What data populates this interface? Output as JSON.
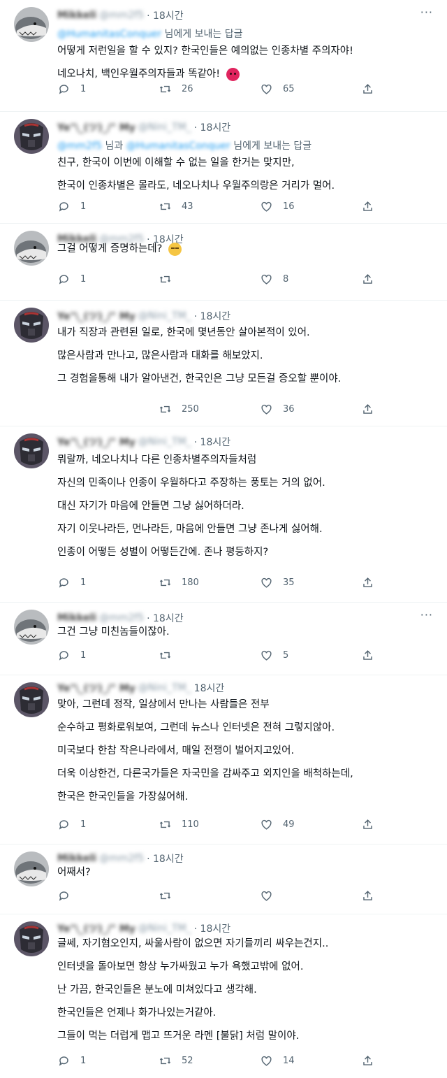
{
  "tweets": [
    {
      "author": "shark",
      "name": "Mikkeli",
      "handle": "@mm2f5",
      "time": "· 18시간",
      "reply_prefix": "",
      "reply_mention1": "@HumanitasConquer",
      "reply_mid": "",
      "reply_mention2": "",
      "reply_suffix": "님에게 보내는 답글",
      "lines": [
        "어떻게 저런일을 할 수 있지? 한국인들은 예의없는 인종차별 주의자야!",
        "네오나치, 백인우월주의자들과 똑같아!"
      ],
      "emoji": "angry-face-emoji",
      "replies": "1",
      "retweets": "26",
      "likes": "65"
    },
    {
      "author": "mask",
      "name": "Ye\"\\_(ツ)_/\" My",
      "handle": "@Nini_TM_",
      "time": "· 18시간",
      "reply_mention1": "@mm2f5",
      "reply_mid": "님과",
      "reply_mention2": "@HumanitasConquer",
      "reply_suffix": "님에게 보내는 답글",
      "lines": [
        "친구, 한국이 이번에 이해할 수 없는 일을 한거는 맞지만,",
        "한국이 인종차별은 몰라도, 네오나치나 우월주의랑은 거리가 멀어."
      ],
      "replies": "1",
      "retweets": "43",
      "likes": "16"
    },
    {
      "author": "shark",
      "name": "Mikkeli",
      "handle": "@mm2f5",
      "time": "· 18시간",
      "lines": [
        "그걸 어떻게 증명하는데?"
      ],
      "emoji": "unamused-face-emoji",
      "replies": "1",
      "retweets": "",
      "likes": "8"
    },
    {
      "author": "mask",
      "name": "Ye\"\\_(ツ)_/\" My",
      "handle": "@Nini_TM_",
      "time": "· 18시간",
      "lines": [
        "내가 직장과 관련된 일로, 한국에 몇년동안 살아본적이 있어.",
        "많은사람과 만나고, 많은사람과 대화를 해보았지.",
        "그 경험을통해 내가 알아낸건, 한국인은 그냥 모든걸 증오할 뿐이야."
      ],
      "replies": "",
      "retweets": "250",
      "likes": "36"
    },
    {
      "author": "mask",
      "name": "Ye\"\\_(ツ)_/\" My",
      "handle": "@Nini_TM_",
      "time": "· 18시간",
      "lines": [
        "뭐랄까, 네오나치나 다른 인종차별주의자들처럼",
        "자신의 민족이나 인종이 우월하다고 주장하는 풍토는 거의 없어.",
        "대신 자기가 마음에 안들면 그냥 싫어하더라.",
        "자기 이웃나라든, 먼나라든, 마음에 안들면 그냥 존나게 싫어해.",
        "인종이 어떻든 성별이 어떻든간에. 존나 평등하지?"
      ],
      "replies": "1",
      "retweets": "180",
      "likes": "35"
    },
    {
      "author": "shark",
      "name": "Mikkeli",
      "handle": "@mm2f5",
      "time": "· 18시간",
      "lines": [
        "그건 그냥 미친놈들이잖아."
      ],
      "replies": "1",
      "retweets": "",
      "likes": "5"
    },
    {
      "author": "mask",
      "name": "Ye\"\\_(ツ)_/\" My",
      "handle": "@Nini_TM_",
      "time": "18시간",
      "lines": [
        "맞아, 그런데 정작, 일상에서 만나는 사람들은 전부",
        "순수하고 평화로워보여, 그런데 뉴스나 인터넷은 전혀 그렇지않아.",
        "미국보다 한참 작은나라에서, 매일 전쟁이 벌어지고있어.",
        "더욱 이상한건, 다른국가들은 자국민을 감싸주고 외지인을 배척하는데,",
        "한국은 한국인들을 가장싫어해."
      ],
      "replies": "1",
      "retweets": "110",
      "likes": "49"
    },
    {
      "author": "shark",
      "name": "Mikkeli",
      "handle": "@mm2f5",
      "time": "· 18시간",
      "lines": [
        "어째서?"
      ],
      "replies": "",
      "retweets": "",
      "likes": ""
    },
    {
      "author": "mask",
      "name": "Ye\"\\_(ツ)_/\" My",
      "handle": "@Nini_TM_",
      "time": "· 18시간",
      "lines": [
        "글쎄, 자기혐오인지, 싸울사람이 없으면 자기들끼리 싸우는건지..",
        "인터넷을 돌아보면 항상 누가싸웠고 누가 욕했고밖에 없어.",
        "난 가끔, 한국인들은 분노에 미쳐있다고 생각해.",
        "한국인들은 언제나 화가나있는거같아.",
        "그들이 먹는 더럽게 맵고 뜨거운 라멘 [불닭] 처럼 말이야."
      ],
      "replies": "1",
      "retweets": "52",
      "likes": "14"
    }
  ]
}
